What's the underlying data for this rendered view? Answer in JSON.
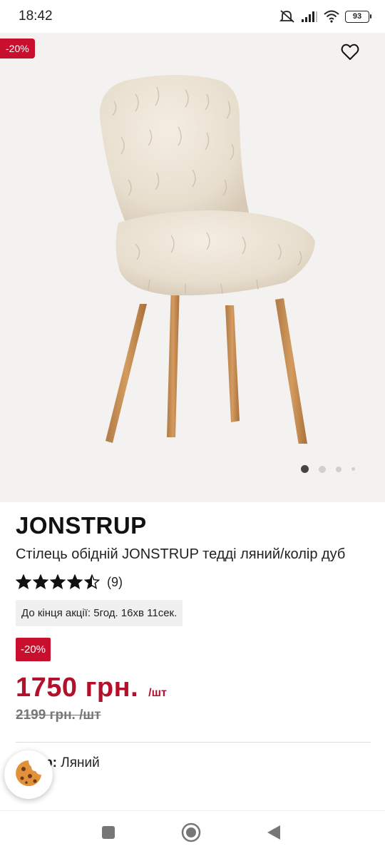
{
  "status_bar": {
    "time": "18:42",
    "battery": "93",
    "icons": [
      "mute-icon",
      "signal-icon",
      "wifi-icon",
      "battery-icon"
    ]
  },
  "gallery": {
    "discount_badge": "-20%",
    "wishlist_icon": "heart-icon",
    "image_count": 4,
    "active_image": 1
  },
  "product": {
    "brand": "JONSTRUP",
    "name": "Стілець обідній JONSTRUP тедді ляний/колір дуб",
    "rating": 4.5,
    "rating_max": 5,
    "review_count": "(9)",
    "countdown": "До кінця акції: 5год. 16хв 11сек.",
    "discount_badge": "-20%",
    "price": "1750 грн.",
    "price_unit": "/шт",
    "old_price": "2199 грн. /шт",
    "color_label": "Колір:",
    "color_value": " Ляний"
  },
  "cookie_button": {
    "icon": "cookie-icon"
  },
  "nav_bar": {
    "buttons": [
      "recents-icon",
      "home-icon",
      "back-icon"
    ]
  },
  "colors": {
    "accent_red": "#c8102e",
    "price_red": "#b3102b",
    "gallery_bg": "#f3f2f0"
  }
}
